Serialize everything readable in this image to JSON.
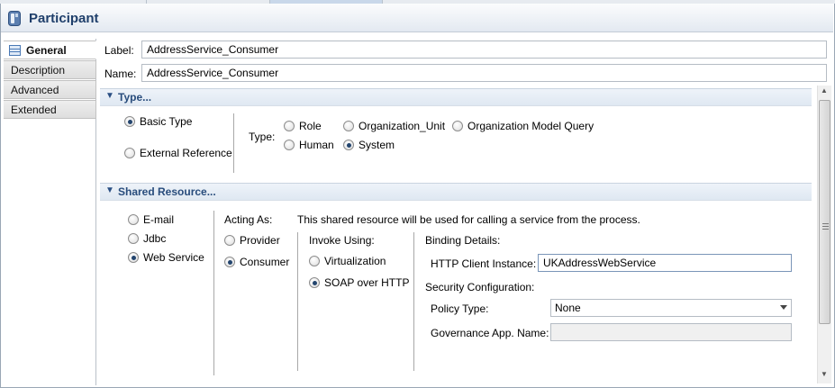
{
  "window": {
    "title": "Participant",
    "icon": "participant-icon"
  },
  "sidebar": {
    "items": [
      {
        "label": "General",
        "icon": "general-table-icon",
        "active": true
      },
      {
        "label": "Description",
        "active": false
      },
      {
        "label": "Advanced",
        "active": false
      },
      {
        "label": "Extended",
        "active": false
      }
    ]
  },
  "general": {
    "label_caption": "Label:",
    "label_value": "AddressService_Consumer",
    "name_caption": "Name:",
    "name_value": "AddressService_Consumer"
  },
  "type_section": {
    "title": "Type...",
    "basic_type": "Basic Type",
    "external_reference": "External Reference",
    "type_caption": "Type:",
    "options": {
      "role": "Role",
      "organization_unit": "Organization_Unit",
      "organization_model_query": "Organization Model Query",
      "human": "Human",
      "system": "System"
    },
    "selected_kind": "Basic Type",
    "selected_type": "System"
  },
  "shared_section": {
    "title": "Shared Resource...",
    "resources": {
      "email": "E-mail",
      "jdbc": "Jdbc",
      "web_service": "Web Service"
    },
    "selected_resource": "Web Service",
    "acting_as_caption": "Acting As:",
    "description": "This shared resource will be used for calling a service from the process.",
    "acting_as": {
      "provider": "Provider",
      "consumer": "Consumer"
    },
    "selected_acting_as": "Consumer",
    "invoke_using_caption": "Invoke Using:",
    "invoke_using": {
      "virtualization": "Virtualization",
      "soap_over_http": "SOAP over HTTP"
    },
    "selected_invoke_using": "SOAP over HTTP",
    "binding_details": "Binding Details:",
    "http_client_caption": "HTTP Client Instance:",
    "http_client_value": "UKAddressWebService",
    "security_configuration": "Security Configuration:",
    "policy_type_caption": "Policy Type:",
    "policy_type_value": "None",
    "governance_caption": "Governance App. Name:",
    "governance_value": ""
  },
  "colors": {
    "section_title": "#284c7c",
    "window_title": "#1f3f6b"
  }
}
